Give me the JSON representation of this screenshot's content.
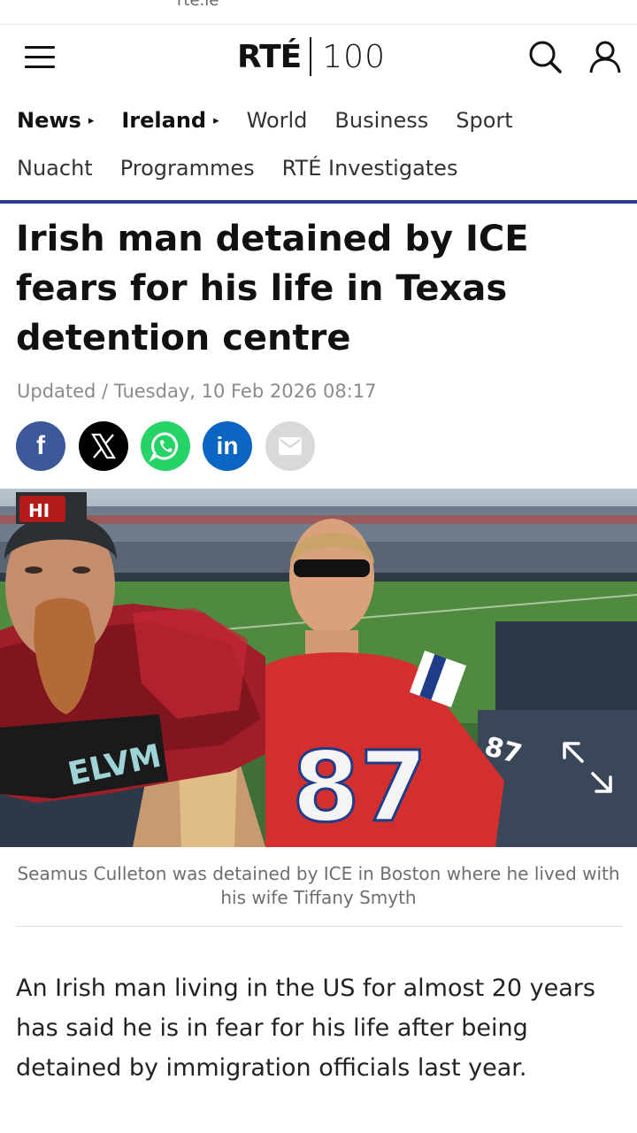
{
  "browser": {
    "url_fragment": "rte.ie"
  },
  "header": {
    "logo_brand": "RTÉ",
    "logo_anniversary": "100",
    "menu_icon": "hamburger-menu-icon",
    "search_icon": "search-icon",
    "account_icon": "user-icon"
  },
  "nav": {
    "row1": [
      {
        "label": "News",
        "has_caret": true
      },
      {
        "label": "Ireland",
        "has_caret": true
      },
      {
        "label": "World"
      },
      {
        "label": "Business"
      },
      {
        "label": "Sport"
      }
    ],
    "row2": [
      {
        "label": "Nuacht"
      },
      {
        "label": "Programmes"
      },
      {
        "label": "RTÉ Investigates"
      }
    ],
    "accent_color": "#2a3b8c"
  },
  "article": {
    "headline": "Irish man detained by ICE fears for his life in Texas detention centre",
    "updated": "Updated / Tuesday, 10 Feb 2026 08:17",
    "share": {
      "facebook": "f",
      "x": "X",
      "whatsapp": "whatsapp-icon",
      "linkedin": "in",
      "email": "email-icon"
    },
    "photo": {
      "jersey_number": "87",
      "expand_icon": "expand-arrows-icon"
    },
    "caption": "Seamus Culleton was detained by ICE in Boston where he lived with his wife Tiffany Smyth",
    "body": "An Irish man living in the US for almost 20 years has said he is in fear for his life after being detained by immigration officials last year."
  }
}
